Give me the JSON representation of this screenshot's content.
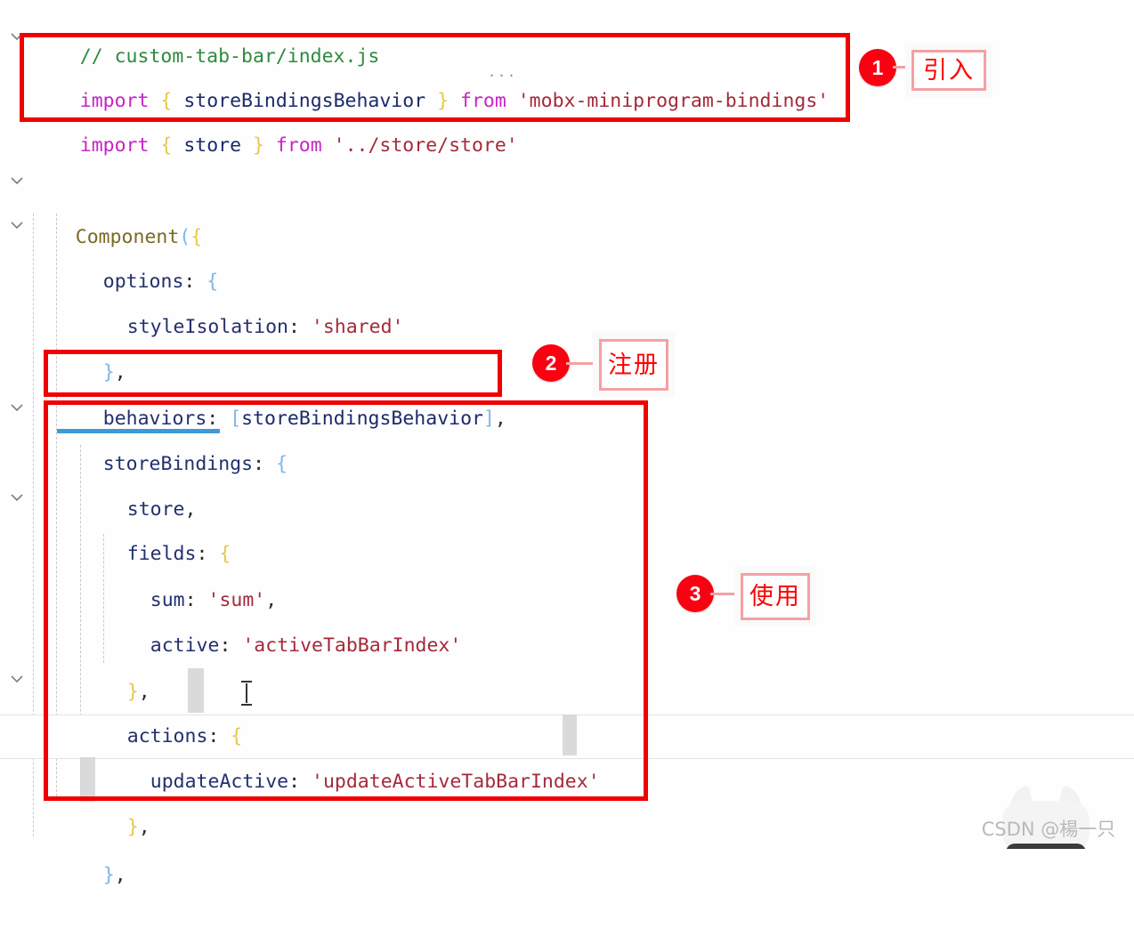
{
  "editor": {
    "file_comment": "// custom-tab-bar/index.js",
    "collapsed_marker": "...",
    "cursor_glyph": "I-beam",
    "lines": [
      {
        "id": "comment",
        "text": "// custom-tab-bar/index.js"
      },
      {
        "id": "import-1",
        "text": "import { storeBindingsBehavior } from 'mobx-miniprogram-bindings'"
      },
      {
        "id": "import-2",
        "text": "import { store } from '../store/store'"
      },
      {
        "id": "component-open",
        "text": "Component({"
      },
      {
        "id": "options-open",
        "text": "options: {"
      },
      {
        "id": "style-isolation",
        "text": "styleIsolation: 'shared'"
      },
      {
        "id": "options-close",
        "text": "},"
      },
      {
        "id": "behaviors",
        "text": "behaviors: [storeBindingsBehavior],"
      },
      {
        "id": "storebindings-open",
        "text": "storeBindings: {"
      },
      {
        "id": "store-ref",
        "text": "store,"
      },
      {
        "id": "fields-open",
        "text": "fields: {"
      },
      {
        "id": "field-sum",
        "text": "sum: 'sum',"
      },
      {
        "id": "field-active",
        "text": "active: 'activeTabBarIndex'"
      },
      {
        "id": "fields-close",
        "text": "},"
      },
      {
        "id": "actions-open",
        "text": "actions: {"
      },
      {
        "id": "action-update",
        "text": "updateActive: 'updateActiveTabBarIndex'"
      },
      {
        "id": "actions-close",
        "text": "},"
      },
      {
        "id": "storebindings-close",
        "text": "},"
      }
    ],
    "tokens": {
      "comment": "// custom-tab-bar/index.js",
      "kw_import": "import",
      "kw_from": "from",
      "id_storeBindingsBehavior": "storeBindingsBehavior",
      "id_store": "store",
      "str_mobx": "'mobx-miniprogram-bindings'",
      "str_store_path": "'../store/store'",
      "fn_Component": "Component",
      "prop_options": "options",
      "prop_styleIsolation": "styleIsolation",
      "str_shared": "'shared'",
      "prop_behaviors": "behaviors",
      "prop_storeBindings": "storeBindings",
      "prop_fields": "fields",
      "prop_sum": "sum",
      "str_sum": "'sum'",
      "prop_active": "active",
      "str_activeTabBarIndex": "'activeTabBarIndex'",
      "prop_actions": "actions",
      "prop_updateActive": "updateActive",
      "str_updateActiveTabBarIndex": "'updateActiveTabBarIndex'"
    },
    "colors": {
      "comment": "#2e8b3c",
      "keyword": "#c724c7",
      "identifier": "#1b2a6b",
      "string": "#a52a3a",
      "curly_brace": "#e6c84a",
      "square_bracket": "#7fb6e8",
      "function": "#7a6a24",
      "underline_highlight": "#3e9ad6",
      "background": "#fefefe"
    }
  },
  "annotations": {
    "accent_color": "#f00000",
    "badge_color": "#fa0011",
    "callout_border": "#f4a0a4",
    "callout_text_color": "#ff0000",
    "items": [
      {
        "number": "1",
        "label": "引入"
      },
      {
        "number": "2",
        "label": "注册"
      },
      {
        "number": "3",
        "label": "使用"
      }
    ]
  },
  "watermark": {
    "text": "CSDN @楊一只"
  }
}
